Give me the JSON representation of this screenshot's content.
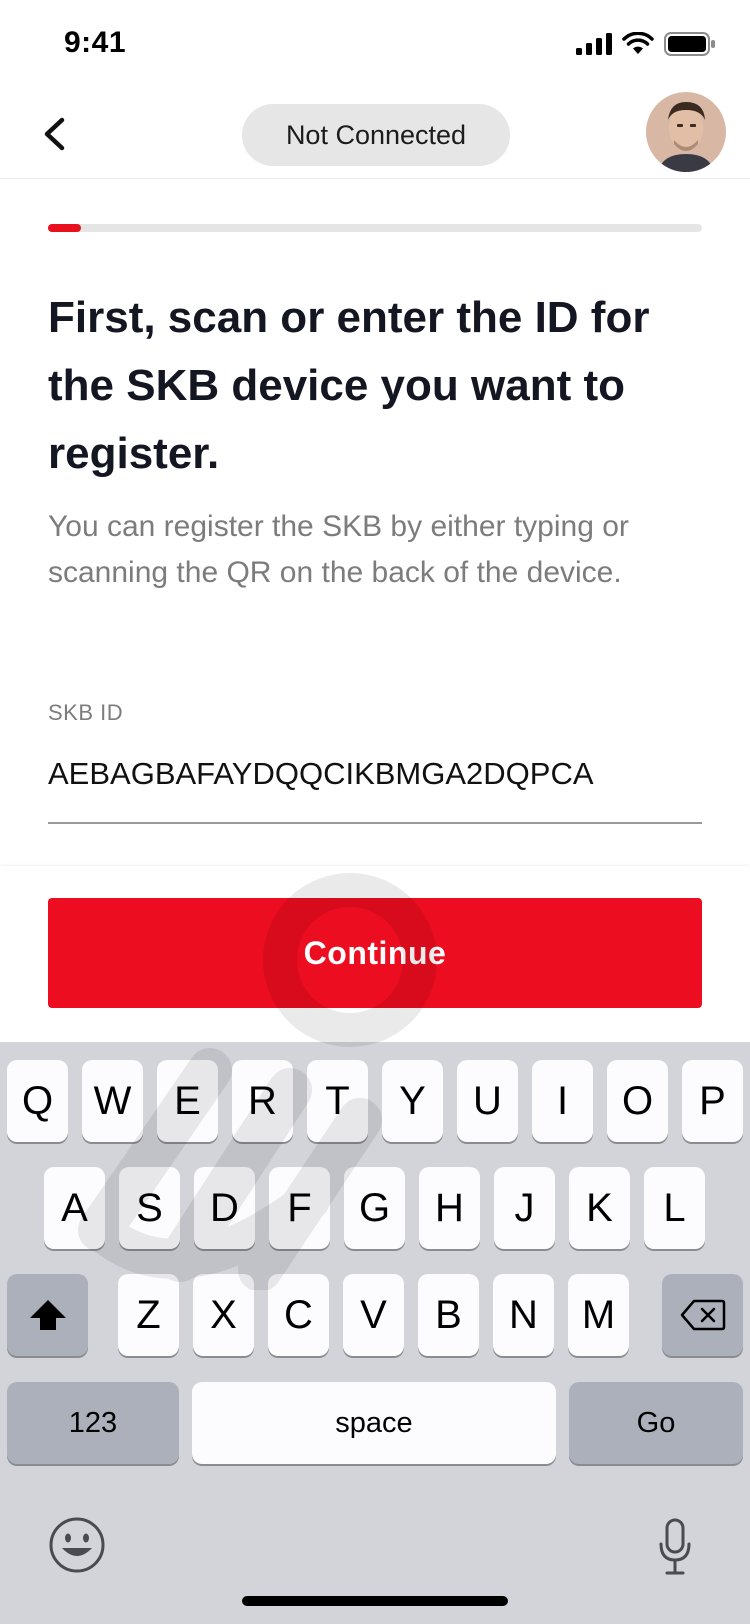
{
  "status_bar": {
    "time": "9:41"
  },
  "nav": {
    "status_label": "Not Connected"
  },
  "progress": {
    "fraction": 0.05
  },
  "content": {
    "headline": "First, scan or enter the ID for the SKB device you want to register.",
    "description": "You can register the SKB by either typing or scanning the QR on the back of the device.",
    "field_label": "SKB ID",
    "field_value": "AEBAGBAFAYDQQCIKBMGA2DQPCA"
  },
  "continue_label": "Continue",
  "keyboard": {
    "row1": [
      "Q",
      "W",
      "E",
      "R",
      "T",
      "Y",
      "U",
      "I",
      "O",
      "P"
    ],
    "row2": [
      "A",
      "S",
      "D",
      "F",
      "G",
      "H",
      "J",
      "K",
      "L"
    ],
    "row3": [
      "Z",
      "X",
      "C",
      "V",
      "B",
      "N",
      "M"
    ],
    "numbers_label": "123",
    "space_label": "space",
    "go_label": "Go"
  },
  "colors": {
    "accent": "#ec0d20",
    "keyboard_bg": "#d2d4d9"
  }
}
